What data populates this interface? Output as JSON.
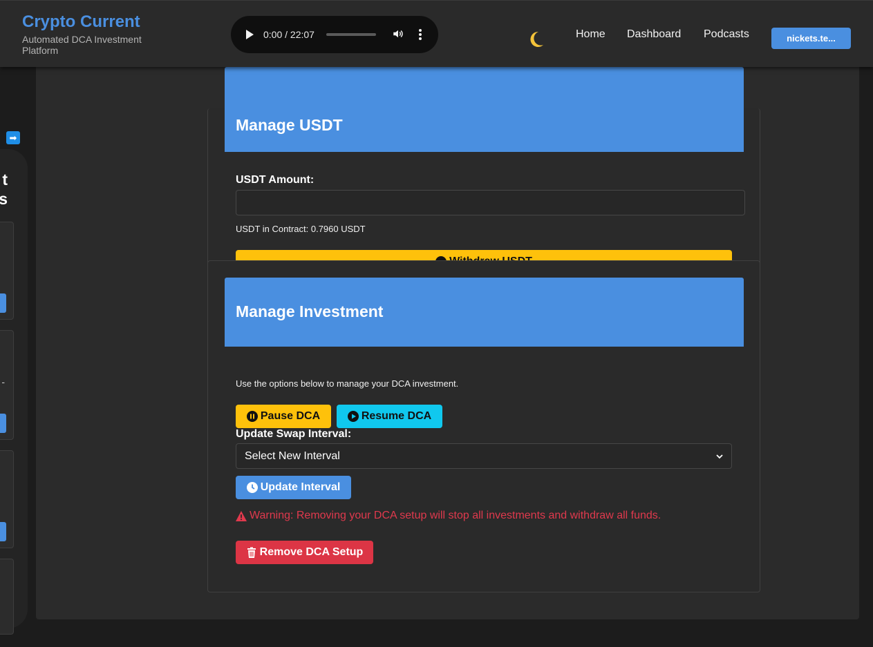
{
  "header": {
    "brand_title": "Crypto Current",
    "brand_subtitle": "Automated DCA Investment Platform",
    "audio": {
      "time": "0:00 / 22:07",
      "progress": 0
    },
    "nav": {
      "home": "Home",
      "dashboard": "Dashboard",
      "podcasts": "Podcasts"
    },
    "wallet_label": "nickets.te..."
  },
  "sidebar": {
    "heading_fragment": "t\ns",
    "card_text_fragment": "-"
  },
  "usdt": {
    "title": "Manage USDT",
    "amount_label": "USDT Amount:",
    "amount_value": "",
    "contract_info": "USDT in Contract: 0.7960 USDT",
    "withdraw_label": "Withdraw USDT"
  },
  "investment": {
    "title": "Manage Investment",
    "description": "Use the options below to manage your DCA investment.",
    "pause_label": "Pause DCA",
    "resume_label": "Resume DCA",
    "interval_label": "Update Swap Interval:",
    "interval_selected": "Select New Interval",
    "update_label": "Update Interval",
    "warning": "Warning: Removing your DCA setup will stop all investments and withdraw all funds.",
    "remove_label": "Remove DCA Setup"
  },
  "colors": {
    "accent": "#4a8fe0",
    "warning_yellow": "#fec10b",
    "info_cyan": "#10c8ee",
    "danger": "#dc3545"
  }
}
